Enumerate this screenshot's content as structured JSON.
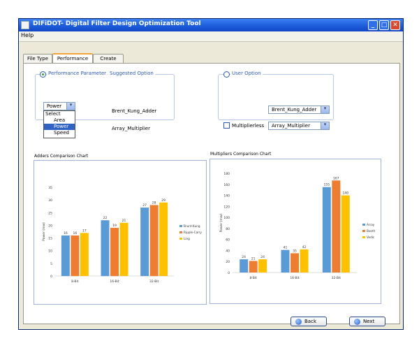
{
  "window": {
    "title": "DIFiDOT- Digital Filter Design Optimization Tool"
  },
  "menu": {
    "help": "Help"
  },
  "tabs": [
    {
      "label": "File Type"
    },
    {
      "label": "Performance"
    },
    {
      "label": "Create"
    }
  ],
  "performance": {
    "param_label": "Performance Parameter",
    "suggested_label": "Suggested Option",
    "selected": "Power",
    "dropdown_options": [
      "Select",
      "Area",
      "Power",
      "Speed"
    ],
    "suggested_adder": "Brent_Kung_Adder",
    "suggested_multiplier": "Array_Multiplier"
  },
  "user_option": {
    "label": "User Option",
    "adder_value": "Brent_Kung_Adder",
    "multiplierless_label": "Multiplierless",
    "multiplier_value": "Array_Multiplier"
  },
  "buttons": {
    "back": "Back",
    "next": "Next"
  },
  "colors": {
    "blue": "#5b9bd5",
    "orange": "#ed7d31",
    "yellow": "#ffc000"
  },
  "chart_data": [
    {
      "type": "bar",
      "title": "Adders Comparison Chart",
      "ylabel": "Power (mw)",
      "ylim": [
        0,
        35
      ],
      "yticks": [
        0,
        5,
        10,
        15,
        20,
        25,
        30,
        35
      ],
      "categories": [
        "8-Bit",
        "16-Bit",
        "32-Bit"
      ],
      "series": [
        {
          "name": "Brunt-Kung",
          "values": [
            16,
            22,
            27
          ]
        },
        {
          "name": "Ripple-Carry",
          "values": [
            16,
            19,
            28
          ]
        },
        {
          "name": "Ling",
          "values": [
            17,
            21,
            29
          ]
        }
      ],
      "legend": "right"
    },
    {
      "type": "bar",
      "title": "Multipliers Comparison Chart",
      "ylabel": "Power (mw)",
      "ylim": [
        0,
        180
      ],
      "yticks": [
        0,
        20,
        40,
        60,
        80,
        100,
        120,
        140,
        160,
        180
      ],
      "categories": [
        "8-Bit",
        "16-Bit",
        "32-Bit"
      ],
      "series": [
        {
          "name": "Array",
          "values": [
            24,
            41,
            155
          ]
        },
        {
          "name": "Booth",
          "values": [
            21,
            35,
            167
          ]
        },
        {
          "name": "Vedic",
          "values": [
            24,
            42,
            140
          ]
        }
      ],
      "legend": "right"
    }
  ]
}
